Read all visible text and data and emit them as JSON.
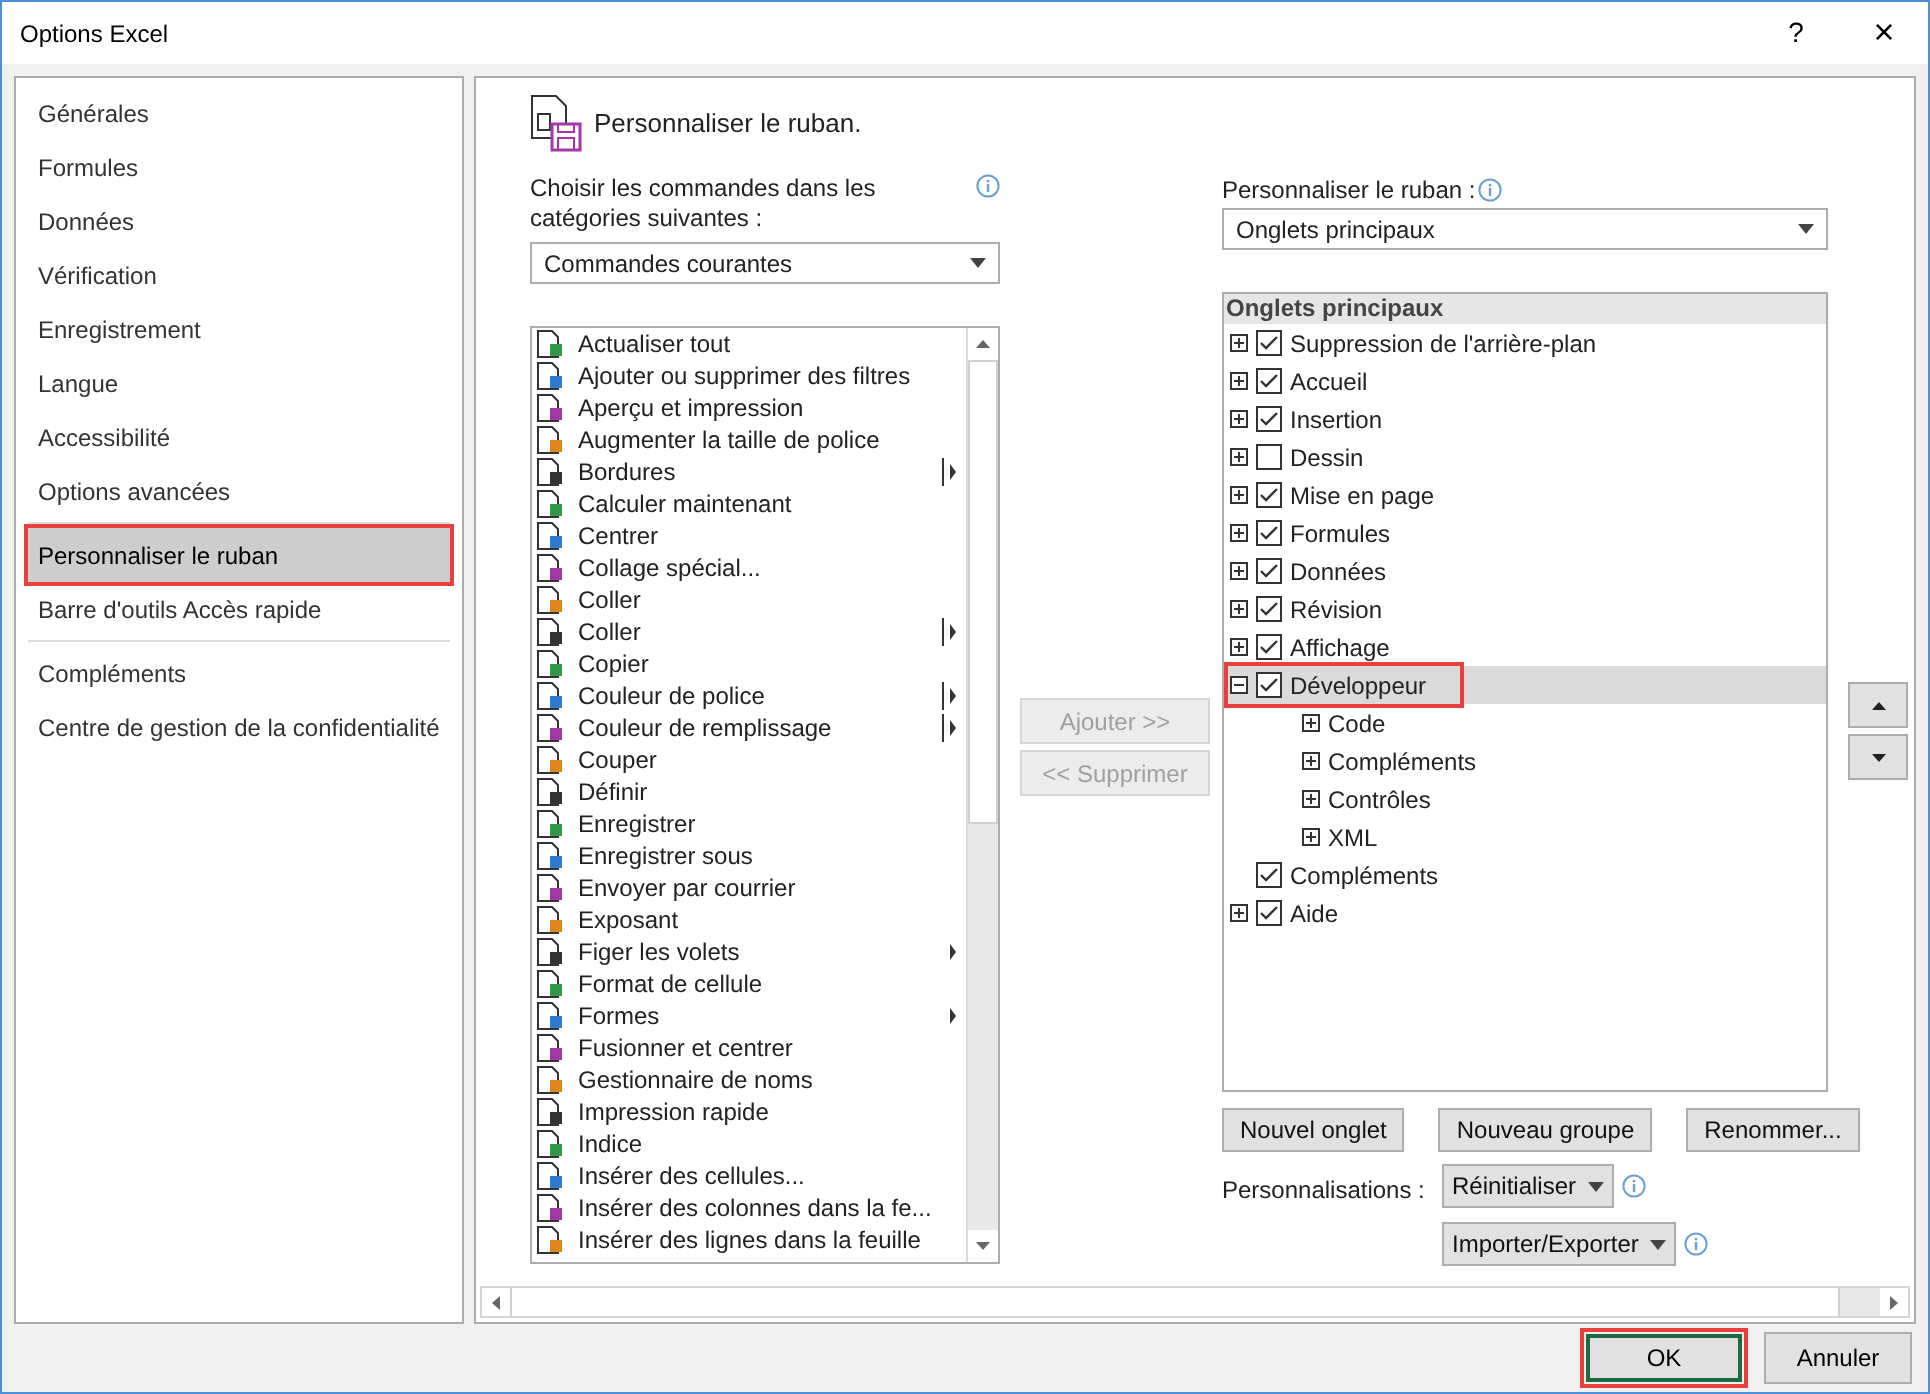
{
  "window": {
    "title": "Options Excel",
    "help": "?",
    "close": "×"
  },
  "sidebar": {
    "groups": [
      [
        {
          "label": "Générales",
          "selected": false,
          "highlighted": false
        },
        {
          "label": "Formules",
          "selected": false,
          "highlighted": false
        },
        {
          "label": "Données",
          "selected": false,
          "highlighted": false
        },
        {
          "label": "Vérification",
          "selected": false,
          "highlighted": false
        },
        {
          "label": "Enregistrement",
          "selected": false,
          "highlighted": false
        },
        {
          "label": "Langue",
          "selected": false,
          "highlighted": false
        },
        {
          "label": "Accessibilité",
          "selected": false,
          "highlighted": false
        },
        {
          "label": "Options avancées",
          "selected": false,
          "highlighted": false
        }
      ],
      [
        {
          "label": "Personnaliser le ruban",
          "selected": true,
          "highlighted": true
        },
        {
          "label": "Barre d'outils Accès rapide",
          "selected": false,
          "highlighted": false
        }
      ],
      [
        {
          "label": "Compléments",
          "selected": false,
          "highlighted": false
        },
        {
          "label": "Centre de gestion de la confidentialité",
          "selected": false,
          "highlighted": false
        }
      ]
    ]
  },
  "page_title": "Personnaliser le ruban.",
  "commands": {
    "label": "Choisir les commandes dans les catégories suivantes :",
    "dropdown": "Commandes courantes",
    "items": [
      {
        "label": "Actualiser tout",
        "kind": "plain"
      },
      {
        "label": "Ajouter ou supprimer des filtres",
        "kind": "plain"
      },
      {
        "label": "Aperçu et impression",
        "kind": "plain"
      },
      {
        "label": "Augmenter la taille de police",
        "kind": "plain"
      },
      {
        "label": "Bordures",
        "kind": "split"
      },
      {
        "label": "Calculer maintenant",
        "kind": "plain"
      },
      {
        "label": "Centrer",
        "kind": "plain"
      },
      {
        "label": "Collage spécial...",
        "kind": "plain"
      },
      {
        "label": "Coller",
        "kind": "plain"
      },
      {
        "label": "Coller",
        "kind": "split"
      },
      {
        "label": "Copier",
        "kind": "plain"
      },
      {
        "label": "Couleur de police",
        "kind": "split"
      },
      {
        "label": "Couleur de remplissage",
        "kind": "split"
      },
      {
        "label": "Couper",
        "kind": "plain"
      },
      {
        "label": "Définir",
        "kind": "plain"
      },
      {
        "label": "Enregistrer",
        "kind": "plain"
      },
      {
        "label": "Enregistrer sous",
        "kind": "plain"
      },
      {
        "label": "Envoyer par courrier",
        "kind": "plain"
      },
      {
        "label": "Exposant",
        "kind": "plain"
      },
      {
        "label": "Figer les volets",
        "kind": "menu"
      },
      {
        "label": "Format de cellule",
        "kind": "plain"
      },
      {
        "label": "Formes",
        "kind": "menu"
      },
      {
        "label": "Fusionner et centrer",
        "kind": "plain"
      },
      {
        "label": "Gestionnaire de noms",
        "kind": "plain"
      },
      {
        "label": "Impression rapide",
        "kind": "plain"
      },
      {
        "label": "Indice",
        "kind": "plain"
      },
      {
        "label": "Insérer des cellules...",
        "kind": "plain"
      },
      {
        "label": "Insérer des colonnes dans la fe...",
        "kind": "plain"
      },
      {
        "label": "Insérer des lignes dans la feuille",
        "kind": "plain"
      }
    ]
  },
  "add_button": {
    "label": "Ajouter >>",
    "disabled": true
  },
  "remove_button": {
    "label": "<< Supprimer",
    "disabled": true
  },
  "ribbon": {
    "label": "Personnaliser le ruban :",
    "dropdown": "Onglets principaux",
    "header": "Onglets principaux",
    "items": [
      {
        "label": "Suppression de l'arrière-plan",
        "checked": true,
        "expanded": false,
        "selected": false,
        "highlighted": false
      },
      {
        "label": "Accueil",
        "checked": true,
        "expanded": false,
        "selected": false,
        "highlighted": false
      },
      {
        "label": "Insertion",
        "checked": true,
        "expanded": false,
        "selected": false,
        "highlighted": false
      },
      {
        "label": "Dessin",
        "checked": false,
        "expanded": false,
        "selected": false,
        "highlighted": false
      },
      {
        "label": "Mise en page",
        "checked": true,
        "expanded": false,
        "selected": false,
        "highlighted": false
      },
      {
        "label": "Formules",
        "checked": true,
        "expanded": false,
        "selected": false,
        "highlighted": false
      },
      {
        "label": "Données",
        "checked": true,
        "expanded": false,
        "selected": false,
        "highlighted": false
      },
      {
        "label": "Révision",
        "checked": true,
        "expanded": false,
        "selected": false,
        "highlighted": false
      },
      {
        "label": "Affichage",
        "checked": true,
        "expanded": false,
        "selected": false,
        "highlighted": false
      },
      {
        "label": "Développeur",
        "checked": true,
        "expanded": true,
        "selected": true,
        "highlighted": true,
        "children": [
          {
            "label": "Code",
            "expanded": false,
            "selected": false,
            "highlighted": false
          },
          {
            "label": "Compléments",
            "expanded": false,
            "selected": false,
            "highlighted": false
          },
          {
            "label": "Contrôles",
            "expanded": false,
            "selected": false,
            "highlighted": false
          },
          {
            "label": "XML",
            "expanded": false,
            "selected": false,
            "highlighted": false
          }
        ]
      },
      {
        "label": "Compléments",
        "checked": true,
        "selected": false,
        "highlighted": false
      },
      {
        "label": "Aide",
        "checked": true,
        "expanded": false,
        "selected": false,
        "highlighted": false
      }
    ]
  },
  "tree_buttons": [
    "Nouvel onglet",
    "Nouveau groupe",
    "Renommer..."
  ],
  "customizations": {
    "label": "Personnalisations :",
    "reset": "Réinitialiser",
    "import_export": "Importer/Exporter"
  },
  "footer": {
    "ok": {
      "label": "OK",
      "highlighted": true
    },
    "cancel": {
      "label": "Annuler",
      "highlighted": false
    }
  }
}
